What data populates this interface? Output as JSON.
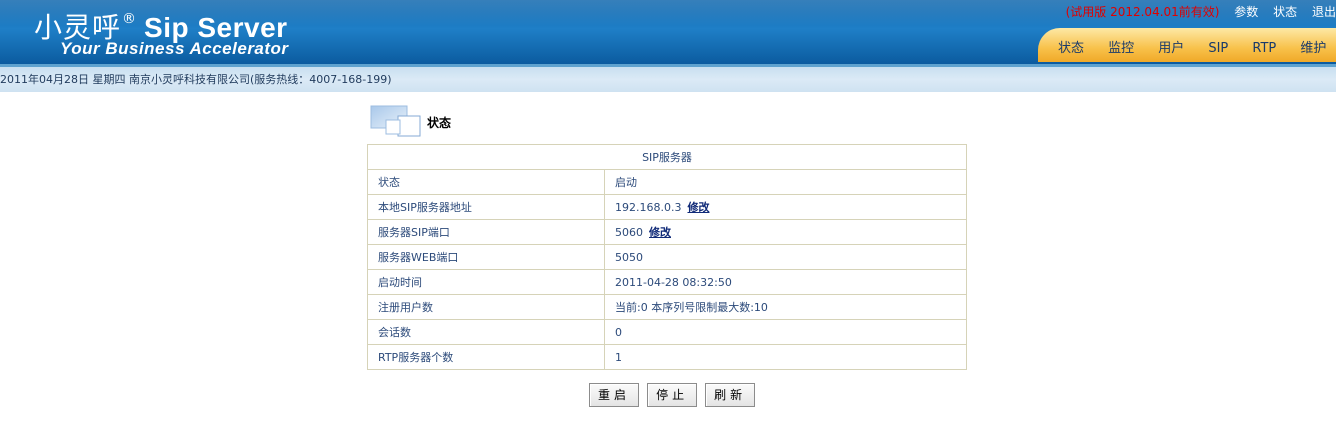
{
  "header": {
    "brand_cn": "小灵呼",
    "brand_reg": "®",
    "brand_en": "Sip Server",
    "slogan": "Your Business Accelerator",
    "trial_text": "(试用版 2012.04.01前有效)",
    "links": [
      "参数",
      "状态",
      "退出"
    ],
    "nav": [
      "状态",
      "监控",
      "用户",
      "SIP",
      "RTP",
      "维护"
    ]
  },
  "datebar": {
    "text": "2011年04月28日  星期四  南京小灵呼科技有限公司(服务热线：4007-168-199)"
  },
  "section": {
    "title": "状态"
  },
  "table": {
    "header": "SIP服务器",
    "rows": [
      {
        "label": "状态",
        "value": "启动"
      },
      {
        "label": "本地SIP服务器地址",
        "value": "192.168.0.3",
        "link": "修改"
      },
      {
        "label": "服务器SIP端口",
        "value": "5060",
        "link": "修改"
      },
      {
        "label": "服务器WEB端口",
        "value": "5050"
      },
      {
        "label": "启动时间",
        "value": "2011-04-28 08:32:50"
      },
      {
        "label": "注册用户数",
        "value": "当前:0 本序列号限制最大数:10"
      },
      {
        "label": "会话数",
        "value": "0"
      },
      {
        "label": "RTP服务器个数",
        "value": "1"
      }
    ]
  },
  "buttons": {
    "restart": "重启",
    "stop": "停止",
    "refresh": "刷新"
  },
  "colors": {
    "header_blue": "#0a63ab",
    "nav_orange": "#f8c14a",
    "trial_red": "#e00000",
    "table_text": "#2c4a7a",
    "table_border": "#d6d3b8"
  }
}
